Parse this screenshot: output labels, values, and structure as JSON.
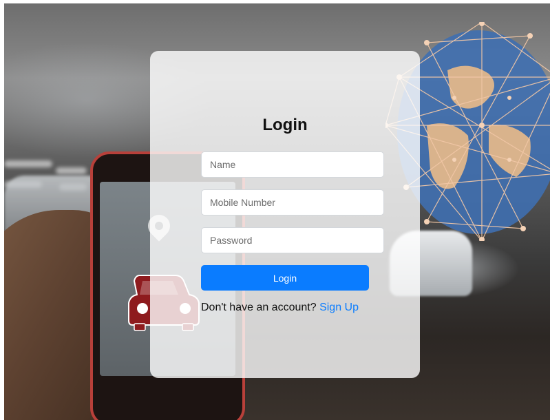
{
  "login_card": {
    "title": "Login",
    "fields": {
      "name": {
        "placeholder": "Name",
        "value": ""
      },
      "mobile": {
        "placeholder": "Mobile Number",
        "value": ""
      },
      "password": {
        "placeholder": "Password",
        "value": ""
      }
    },
    "login_button_label": "Login",
    "signup_prompt": "Don't have an account?",
    "signup_link_label": "Sign Up"
  },
  "background": {
    "icons": [
      "map-pin-icon",
      "car-icon",
      "network-globe-icon"
    ]
  },
  "colors": {
    "accent": "#0a7cff",
    "card_background": "#ffffff",
    "car_icon": "#8e1b1e",
    "globe_network": "#f1c7a6",
    "globe_ocean": "#3f6fb0"
  }
}
